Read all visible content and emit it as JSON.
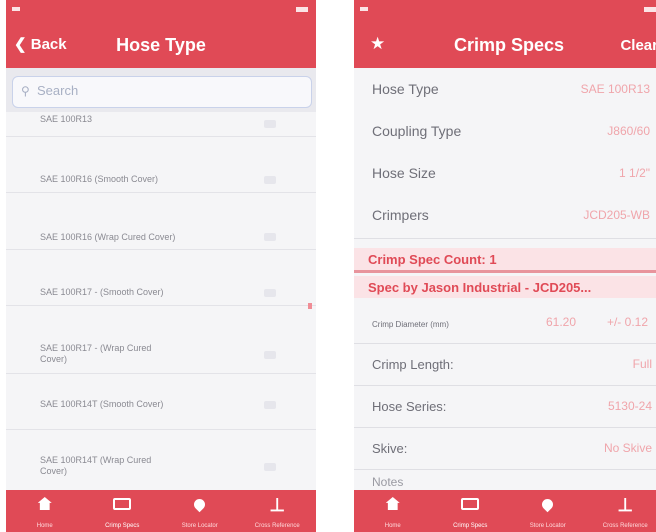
{
  "left_screen": {
    "back_label": "Back",
    "title": "Hose Type",
    "search_placeholder": "Search",
    "items": [
      {
        "label": "SAE 100R13"
      },
      {
        "label": "SAE 100R16 (Smooth Cover)"
      },
      {
        "label": "SAE 100R16 (Wrap Cured Cover)"
      },
      {
        "label": "SAE 100R17 - (Smooth Cover)"
      },
      {
        "label": "SAE 100R17 - (Wrap Cured Cover)"
      },
      {
        "label": "SAE 100R14T (Smooth Cover)"
      },
      {
        "label": "SAE 100R14T (Wrap Cured Cover)"
      }
    ]
  },
  "right_screen": {
    "title": "Crimp Specs",
    "clear_label": "Clear",
    "fields": [
      {
        "label": "Hose Type",
        "value": "SAE 100R13"
      },
      {
        "label": "Coupling Type",
        "value": "J860/60"
      },
      {
        "label": "Hose Size",
        "value": "1 1/2\""
      },
      {
        "label": "Crimpers",
        "value": "JCD205-WB"
      }
    ],
    "count_header": "Crimp Spec Count: 1",
    "spec_header": "Spec by Jason Industrial - JCD205...",
    "crimp_diameter": {
      "label": "Crimp Diameter (mm)",
      "value": "61.20",
      "tolerance": "+/- 0.12"
    },
    "details": [
      {
        "label": "Crimp Length:",
        "value": "Full"
      },
      {
        "label": "Hose Series:",
        "value": "5130-24"
      },
      {
        "label": "Skive:",
        "value": "No Skive"
      }
    ],
    "cut_label": "Notes"
  },
  "tabbar": {
    "tabs": [
      {
        "label": "Home",
        "icon": "home-icon"
      },
      {
        "label": "Crimp Specs",
        "icon": "crimp-card-icon"
      },
      {
        "label": "Store Locator",
        "icon": "location-pin-icon"
      },
      {
        "label": "Cross Reference",
        "icon": "cross-reference-icon"
      }
    ]
  },
  "colors": {
    "accent": "#e04a56",
    "value_text": "#f0a5ab",
    "section_bg": "#fbe3e6"
  }
}
